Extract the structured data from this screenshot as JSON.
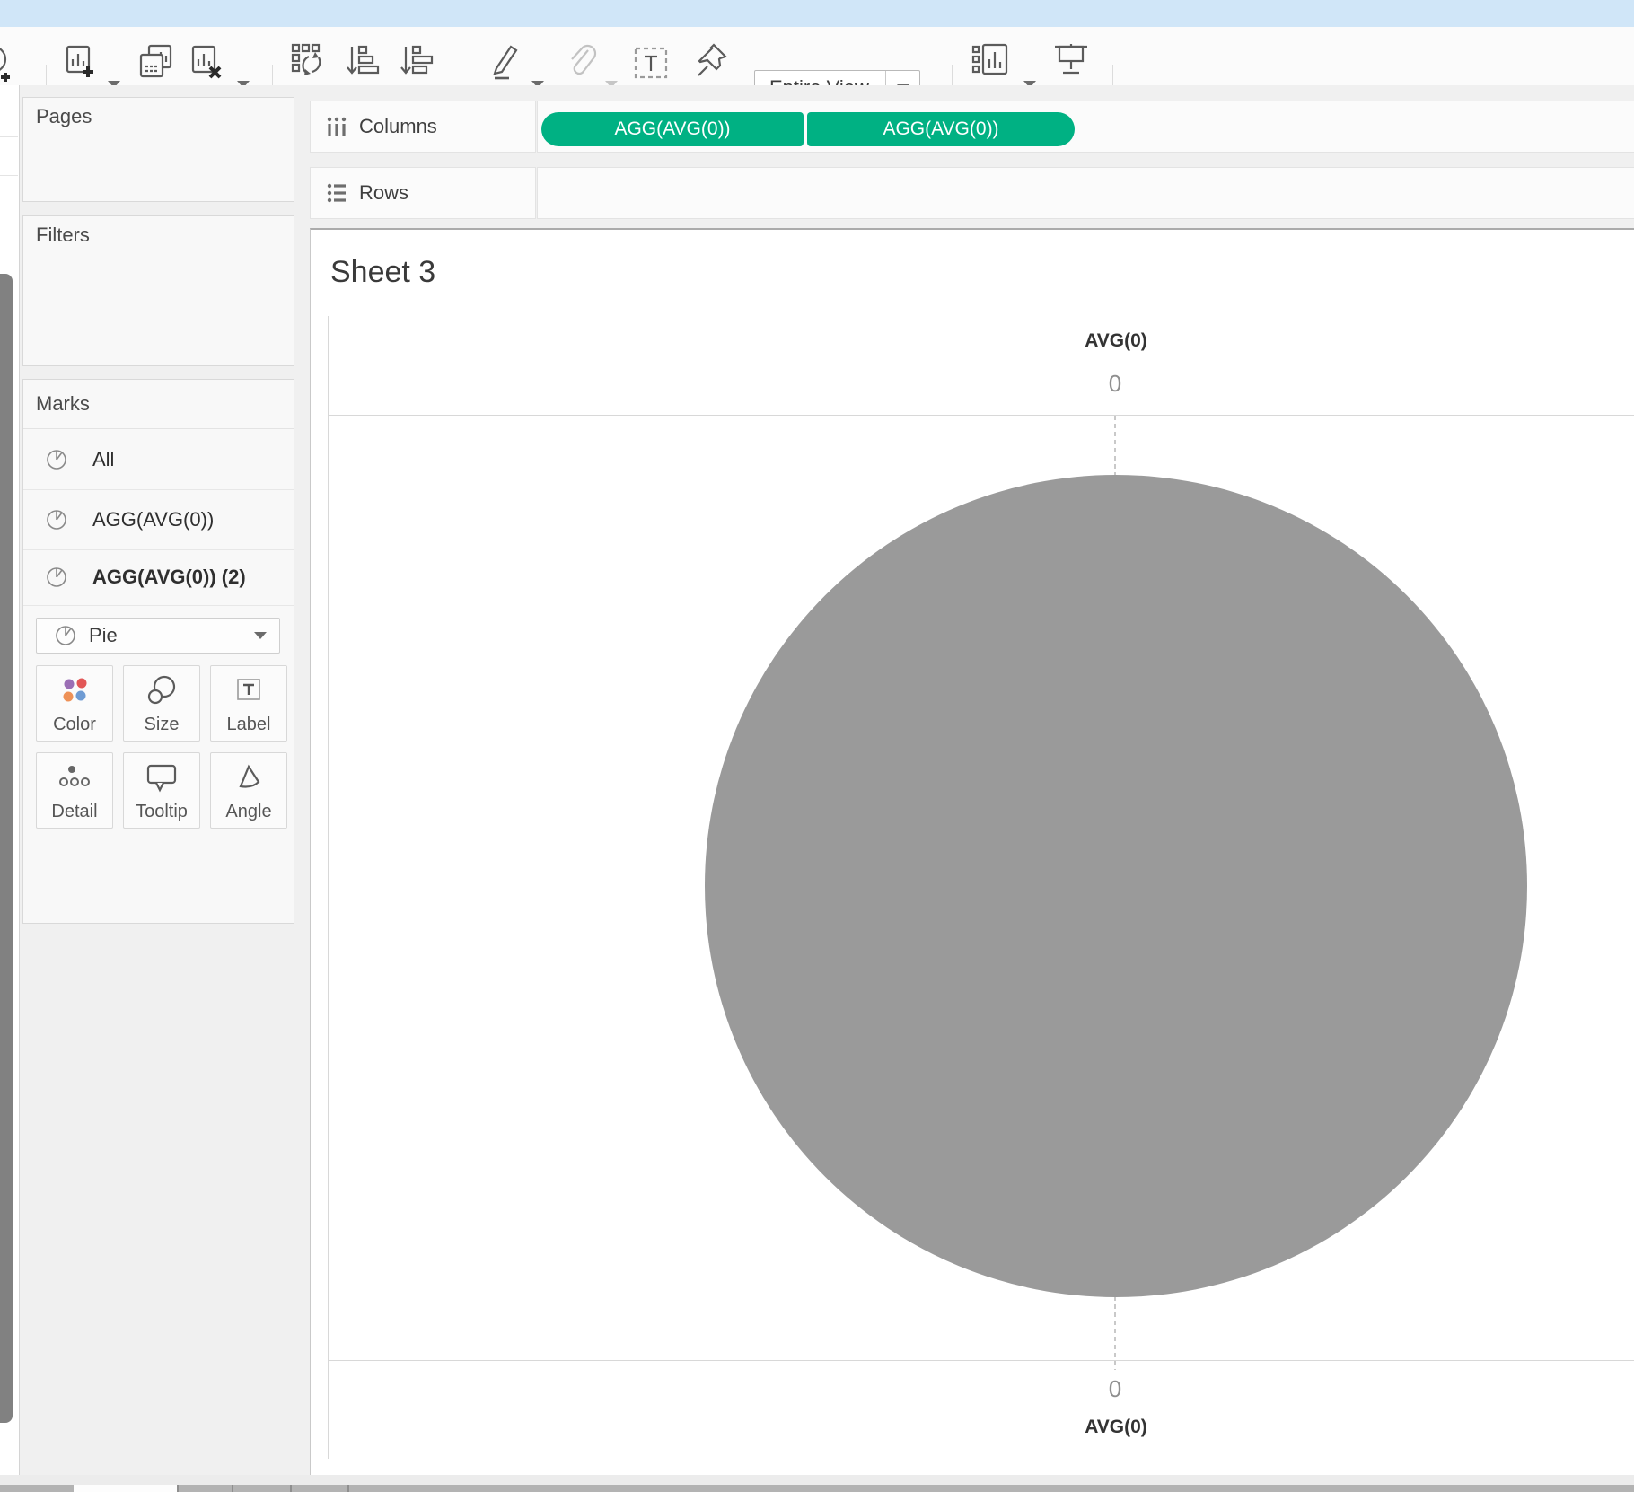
{
  "toolbar": {
    "entire_view": "Entire View",
    "icons": [
      "add-data-source",
      "new-worksheet",
      "duplicate-sheet",
      "clear-sheet",
      "swap-rows-and-columns",
      "sort-ascending",
      "sort-descending",
      "highlight",
      "paperclip",
      "text-annotation",
      "pin",
      "fit-selector",
      "show-me",
      "presentation-mode"
    ]
  },
  "panels": {
    "pages": "Pages",
    "filters": "Filters"
  },
  "marks": {
    "header": "Marks",
    "items": [
      {
        "label": "All"
      },
      {
        "label": "AGG(AVG(0))"
      },
      {
        "label": "AGG(AVG(0)) (2)"
      }
    ],
    "mark_type": "Pie",
    "buttons": {
      "color": "Color",
      "size": "Size",
      "label": "Label",
      "detail": "Detail",
      "tooltip": "Tooltip",
      "angle": "Angle"
    }
  },
  "shelves": {
    "columns": {
      "label": "Columns",
      "pills": [
        "AGG(AVG(0))",
        "AGG(AVG(0))"
      ]
    },
    "rows": {
      "label": "Rows",
      "pills": []
    }
  },
  "canvas": {
    "title": "Sheet 3",
    "top_axis": {
      "title": "AVG(0)",
      "tick": "0"
    },
    "bottom_axis": {
      "title": "AVG(0)",
      "tick": "0"
    }
  },
  "colors": {
    "pill_green": "#00b183",
    "mark_gray": "#9a9a9a",
    "titlebar_blue": "#d0e6f8"
  },
  "chart_data": {
    "type": "pie",
    "title": "Sheet 3",
    "slices": [
      {
        "label": "AGG(AVG(0))",
        "value": 100,
        "color": "#9a9a9a"
      }
    ],
    "top_axis": {
      "title": "AVG(0)",
      "ticks": [
        "0"
      ]
    },
    "bottom_axis": {
      "title": "AVG(0)",
      "ticks": [
        "0"
      ]
    },
    "legend": "none",
    "notes": "single full-circle pie mark centered on x=0 continuous axes"
  }
}
